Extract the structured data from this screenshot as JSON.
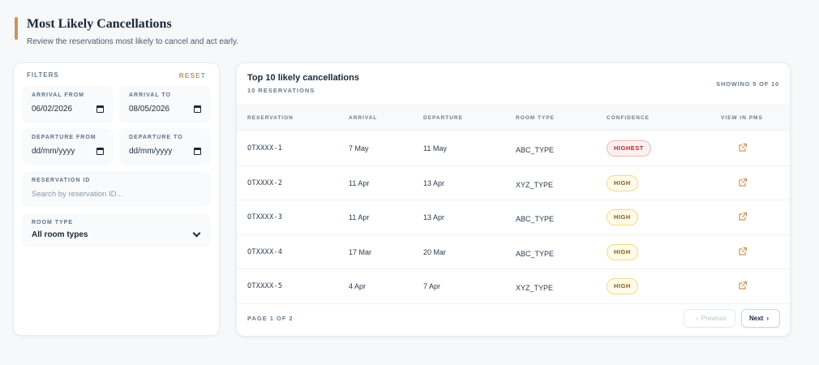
{
  "header": {
    "title": "Most Likely Cancellations",
    "subtitle": "Review the reservations most likely to cancel and act early."
  },
  "filters": {
    "title": "FILTERS",
    "reset_label": "RESET",
    "arrival_from": {
      "label": "ARRIVAL FROM",
      "value": "06/02/2026"
    },
    "arrival_to": {
      "label": "ARRIVAL TO",
      "value": "08/05/2026"
    },
    "departure_from": {
      "label": "DEPARTURE FROM",
      "value": "dd/mm/yyyy"
    },
    "departure_to": {
      "label": "DEPARTURE TO",
      "value": "dd/mm/yyyy"
    },
    "reservation_id": {
      "label": "RESERVATION ID",
      "placeholder": "Search by reservation ID..."
    },
    "room_type": {
      "label": "ROOM TYPE",
      "value": "All room types"
    }
  },
  "table": {
    "title": "Top 10 likely cancellations",
    "subtitle": "10 RESERVATIONS",
    "showing": "SHOWING 5 OF 10",
    "columns": [
      "RESERVATION",
      "ARRIVAL",
      "DEPARTURE",
      "ROOM TYPE",
      "CONFIDENCE",
      "VIEW IN PMS"
    ],
    "rows": [
      {
        "reservation": "OTXXXX-1",
        "arrival": "7 May",
        "departure": "11 May",
        "room_type": "ABC_TYPE",
        "confidence": "HIGHEST"
      },
      {
        "reservation": "OTXXXX-2",
        "arrival": "11 Apr",
        "departure": "13 Apr",
        "room_type": "XYZ_TYPE",
        "confidence": "HIGH"
      },
      {
        "reservation": "OTXXXX-3",
        "arrival": "11 Apr",
        "departure": "13 Apr",
        "room_type": "ABC_TYPE",
        "confidence": "HIGH"
      },
      {
        "reservation": "OTXXXX-4",
        "arrival": "17 Mar",
        "departure": "20 Mar",
        "room_type": "ABC_TYPE",
        "confidence": "HIGH"
      },
      {
        "reservation": "OTXXXX-5",
        "arrival": "4 Apr",
        "departure": "7 Apr",
        "room_type": "XYZ_TYPE",
        "confidence": "HIGH"
      }
    ],
    "page_label": "PAGE 1 OF 2",
    "prev_label": "Previous",
    "next_label": "Next",
    "colors": {
      "accent": "#c8965a",
      "highest": "#b02a2a",
      "high": "#8a5a10"
    },
    "icons": {
      "view": "external-link-icon"
    }
  }
}
